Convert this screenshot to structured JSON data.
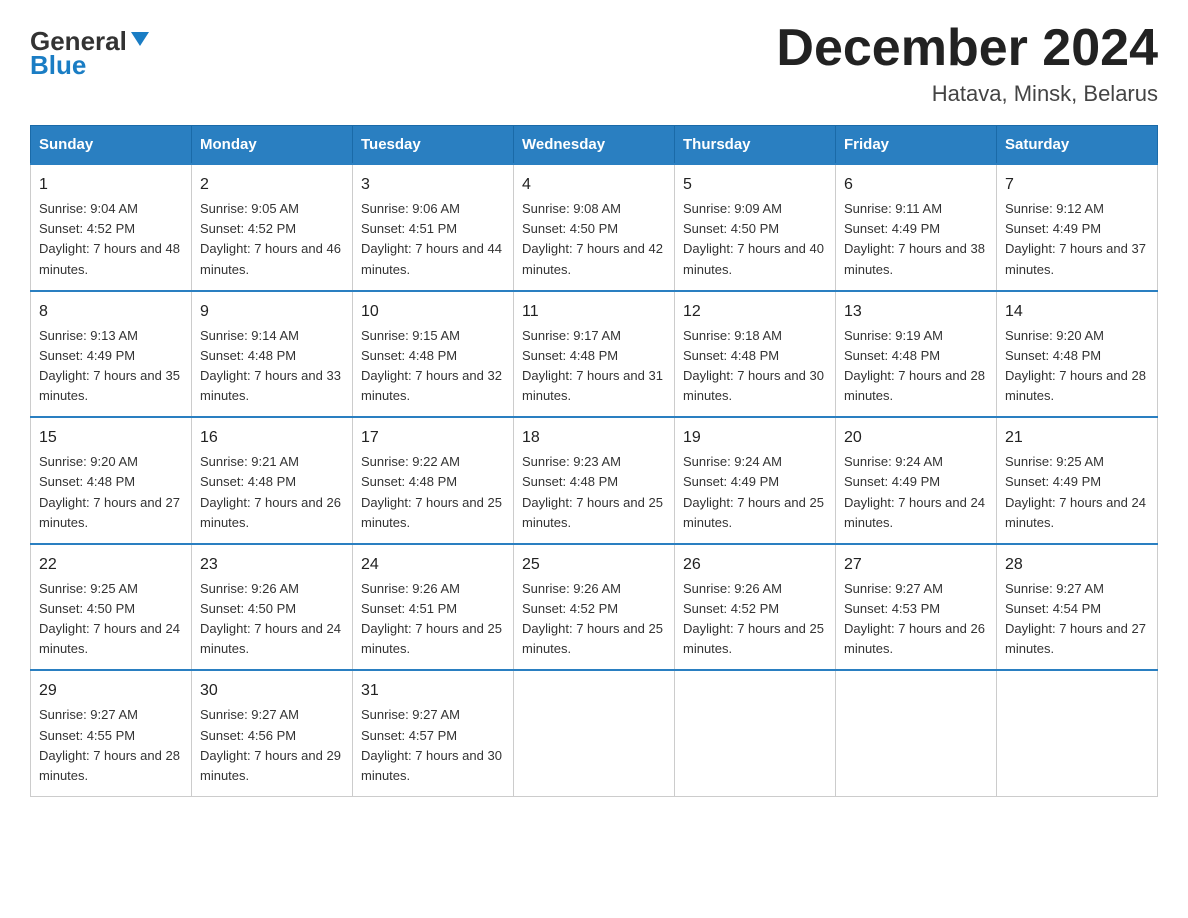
{
  "header": {
    "logo_general": "General",
    "logo_blue": "Blue",
    "month_title": "December 2024",
    "location": "Hatava, Minsk, Belarus"
  },
  "weekdays": [
    "Sunday",
    "Monday",
    "Tuesday",
    "Wednesday",
    "Thursday",
    "Friday",
    "Saturday"
  ],
  "weeks": [
    [
      {
        "day": "1",
        "sunrise": "9:04 AM",
        "sunset": "4:52 PM",
        "daylight": "7 hours and 48 minutes."
      },
      {
        "day": "2",
        "sunrise": "9:05 AM",
        "sunset": "4:52 PM",
        "daylight": "7 hours and 46 minutes."
      },
      {
        "day": "3",
        "sunrise": "9:06 AM",
        "sunset": "4:51 PM",
        "daylight": "7 hours and 44 minutes."
      },
      {
        "day": "4",
        "sunrise": "9:08 AM",
        "sunset": "4:50 PM",
        "daylight": "7 hours and 42 minutes."
      },
      {
        "day": "5",
        "sunrise": "9:09 AM",
        "sunset": "4:50 PM",
        "daylight": "7 hours and 40 minutes."
      },
      {
        "day": "6",
        "sunrise": "9:11 AM",
        "sunset": "4:49 PM",
        "daylight": "7 hours and 38 minutes."
      },
      {
        "day": "7",
        "sunrise": "9:12 AM",
        "sunset": "4:49 PM",
        "daylight": "7 hours and 37 minutes."
      }
    ],
    [
      {
        "day": "8",
        "sunrise": "9:13 AM",
        "sunset": "4:49 PM",
        "daylight": "7 hours and 35 minutes."
      },
      {
        "day": "9",
        "sunrise": "9:14 AM",
        "sunset": "4:48 PM",
        "daylight": "7 hours and 33 minutes."
      },
      {
        "day": "10",
        "sunrise": "9:15 AM",
        "sunset": "4:48 PM",
        "daylight": "7 hours and 32 minutes."
      },
      {
        "day": "11",
        "sunrise": "9:17 AM",
        "sunset": "4:48 PM",
        "daylight": "7 hours and 31 minutes."
      },
      {
        "day": "12",
        "sunrise": "9:18 AM",
        "sunset": "4:48 PM",
        "daylight": "7 hours and 30 minutes."
      },
      {
        "day": "13",
        "sunrise": "9:19 AM",
        "sunset": "4:48 PM",
        "daylight": "7 hours and 28 minutes."
      },
      {
        "day": "14",
        "sunrise": "9:20 AM",
        "sunset": "4:48 PM",
        "daylight": "7 hours and 28 minutes."
      }
    ],
    [
      {
        "day": "15",
        "sunrise": "9:20 AM",
        "sunset": "4:48 PM",
        "daylight": "7 hours and 27 minutes."
      },
      {
        "day": "16",
        "sunrise": "9:21 AM",
        "sunset": "4:48 PM",
        "daylight": "7 hours and 26 minutes."
      },
      {
        "day": "17",
        "sunrise": "9:22 AM",
        "sunset": "4:48 PM",
        "daylight": "7 hours and 25 minutes."
      },
      {
        "day": "18",
        "sunrise": "9:23 AM",
        "sunset": "4:48 PM",
        "daylight": "7 hours and 25 minutes."
      },
      {
        "day": "19",
        "sunrise": "9:24 AM",
        "sunset": "4:49 PM",
        "daylight": "7 hours and 25 minutes."
      },
      {
        "day": "20",
        "sunrise": "9:24 AM",
        "sunset": "4:49 PM",
        "daylight": "7 hours and 24 minutes."
      },
      {
        "day": "21",
        "sunrise": "9:25 AM",
        "sunset": "4:49 PM",
        "daylight": "7 hours and 24 minutes."
      }
    ],
    [
      {
        "day": "22",
        "sunrise": "9:25 AM",
        "sunset": "4:50 PM",
        "daylight": "7 hours and 24 minutes."
      },
      {
        "day": "23",
        "sunrise": "9:26 AM",
        "sunset": "4:50 PM",
        "daylight": "7 hours and 24 minutes."
      },
      {
        "day": "24",
        "sunrise": "9:26 AM",
        "sunset": "4:51 PM",
        "daylight": "7 hours and 25 minutes."
      },
      {
        "day": "25",
        "sunrise": "9:26 AM",
        "sunset": "4:52 PM",
        "daylight": "7 hours and 25 minutes."
      },
      {
        "day": "26",
        "sunrise": "9:26 AM",
        "sunset": "4:52 PM",
        "daylight": "7 hours and 25 minutes."
      },
      {
        "day": "27",
        "sunrise": "9:27 AM",
        "sunset": "4:53 PM",
        "daylight": "7 hours and 26 minutes."
      },
      {
        "day": "28",
        "sunrise": "9:27 AM",
        "sunset": "4:54 PM",
        "daylight": "7 hours and 27 minutes."
      }
    ],
    [
      {
        "day": "29",
        "sunrise": "9:27 AM",
        "sunset": "4:55 PM",
        "daylight": "7 hours and 28 minutes."
      },
      {
        "day": "30",
        "sunrise": "9:27 AM",
        "sunset": "4:56 PM",
        "daylight": "7 hours and 29 minutes."
      },
      {
        "day": "31",
        "sunrise": "9:27 AM",
        "sunset": "4:57 PM",
        "daylight": "7 hours and 30 minutes."
      },
      null,
      null,
      null,
      null
    ]
  ]
}
